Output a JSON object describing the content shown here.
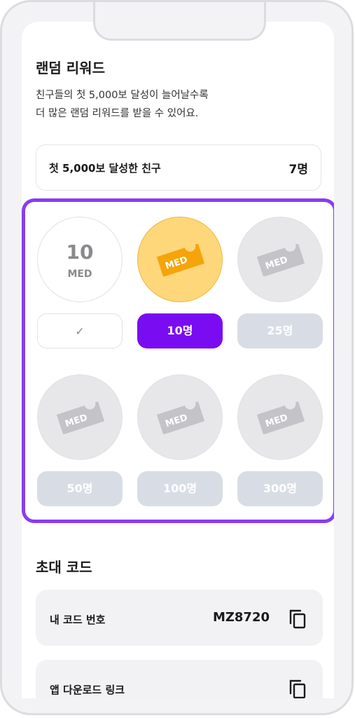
{
  "reward": {
    "title": "랜덤 리워드",
    "description": "친구들의 첫 5,000보 달성이 늘어날수록\n더 많은 랜덤 리워드를 받을 수 있어요.",
    "stat_label": "첫 5,000보 달성한 친구",
    "stat_value": "7명",
    "first_coin": {
      "amount": "10",
      "unit": "MED"
    },
    "ticket_label": "MED",
    "tiers": [
      {
        "state": "claimed",
        "label": "✓"
      },
      {
        "state": "active",
        "label": "10명"
      },
      {
        "state": "locked",
        "label": "25명"
      },
      {
        "state": "locked",
        "label": "50명"
      },
      {
        "state": "locked",
        "label": "100명"
      },
      {
        "state": "locked",
        "label": "300명"
      }
    ]
  },
  "invite": {
    "title": "초대 코드",
    "my_code_label": "내 코드 번호",
    "my_code_value": "MZ8720",
    "app_link_label": "앱 다운로드 링크"
  },
  "colors": {
    "accent": "#7a0cf2",
    "highlight_border": "#8a3cf0",
    "gold": "#fdd77a",
    "ticket_orange": "#f5a40a",
    "locked": "#d8dde5"
  },
  "icons": [
    "check-icon",
    "ticket-icon",
    "copy-icon"
  ]
}
